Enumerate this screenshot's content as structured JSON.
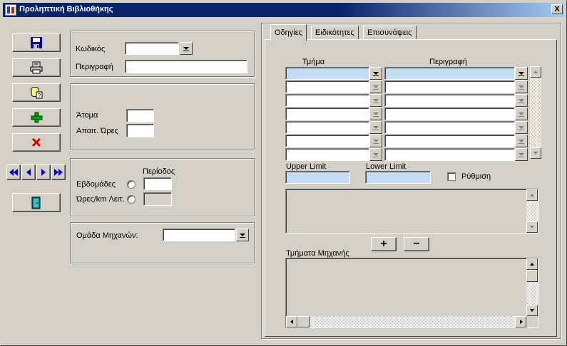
{
  "window": {
    "title": "Προληπτική Βιβλιοθήκης",
    "close_label": "X"
  },
  "toolbar": {
    "buttons": [
      "save-icon",
      "print-icon",
      "query-icon",
      "add-icon",
      "delete-icon",
      "exit-icon"
    ],
    "nav": [
      "first-icon",
      "prev-icon",
      "next-icon",
      "last-icon"
    ]
  },
  "general": {
    "code_label": "Κωδικός",
    "code_value": "",
    "description_label": "Περιγραφή",
    "description_value": ""
  },
  "resources": {
    "persons_label": "Άτομα",
    "persons_value": "",
    "hours_label": "Απαιτ. Ώρες",
    "hours_value": ""
  },
  "period": {
    "title": "Περίοδος",
    "weeks_label": "Εβδομάδες",
    "weeks_value": "",
    "hours_km_label": "Ώρες/km Λειτ.",
    "hours_km_value": ""
  },
  "machine_group": {
    "label": "Ομάδα Μηχανών:",
    "value": ""
  },
  "tabs": [
    {
      "label": "Οδηγίες",
      "active": true
    },
    {
      "label": "Ειδικότητες",
      "active": false
    },
    {
      "label": "Επισυνάψεις",
      "active": false
    }
  ],
  "instructions": {
    "columns": [
      "Τμήμα",
      "Περιγραφή"
    ],
    "rows": [
      {
        "section": "",
        "description": ""
      },
      {
        "section": "",
        "description": ""
      },
      {
        "section": "",
        "description": ""
      },
      {
        "section": "",
        "description": ""
      },
      {
        "section": "",
        "description": ""
      },
      {
        "section": "",
        "description": ""
      },
      {
        "section": "",
        "description": ""
      }
    ],
    "upper_limit_label": "Upper Limit",
    "upper_limit_value": "",
    "lower_limit_label": "Lower Limit",
    "lower_limit_value": "",
    "setting_label": "Ρύθμιση",
    "add_label": "+",
    "remove_label": "−",
    "machine_parts_label": "Τμήματα Μηχανής"
  }
}
